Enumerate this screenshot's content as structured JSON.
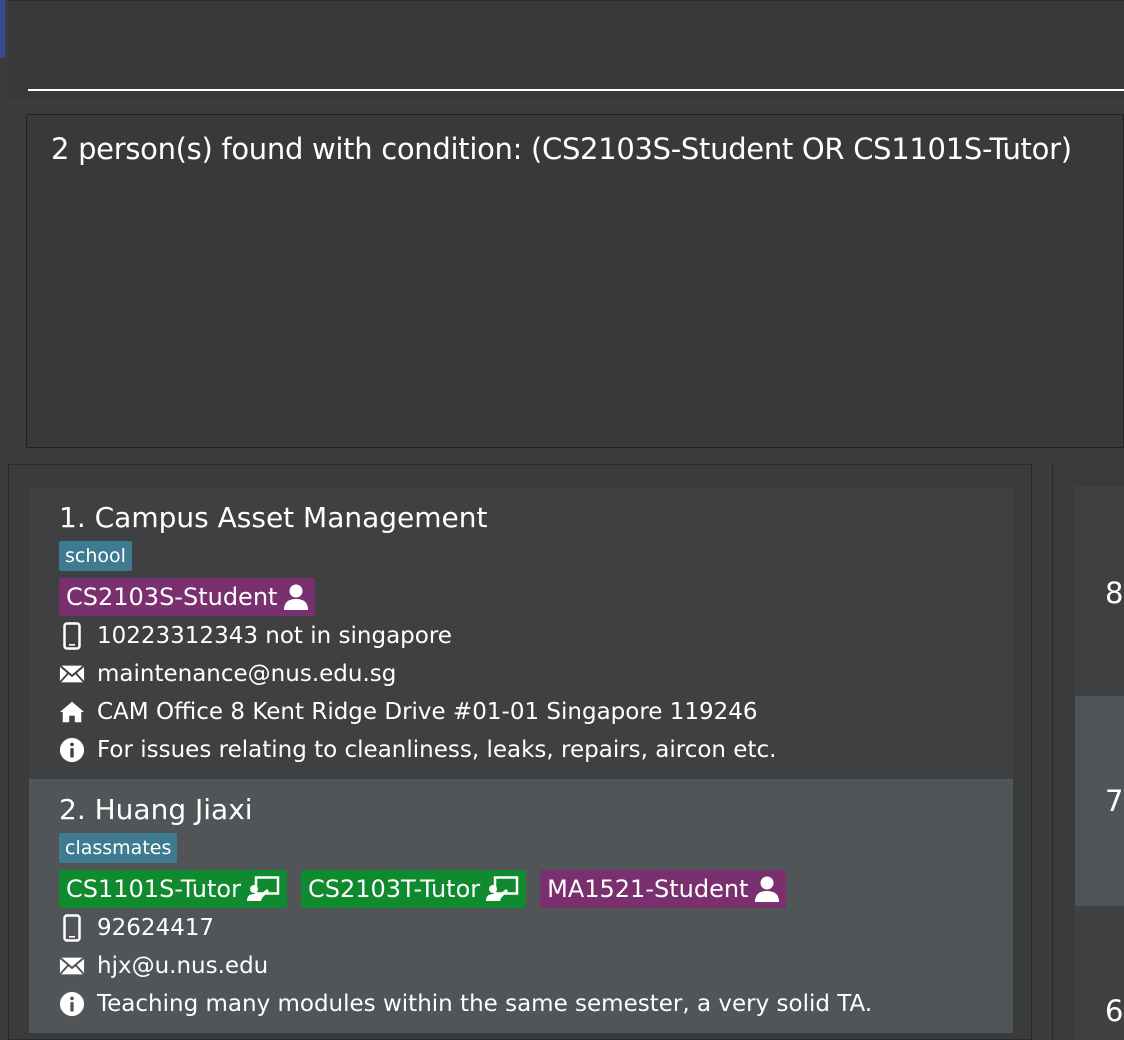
{
  "command": {
    "value": "",
    "placeholder": ""
  },
  "result": {
    "text": "2 person(s) found with condition: (CS2103S-Student OR CS1101S-Tutor)"
  },
  "persons": [
    {
      "name": "1. Campus Asset Management",
      "tags": [
        "school"
      ],
      "modules": [
        {
          "label": "CS2103S-Student",
          "role": "student"
        }
      ],
      "phone": "10223312343 not in singapore",
      "email": "maintenance@nus.edu.sg",
      "address": "CAM Office 8 Kent Ridge Drive #01-01 Singapore 119246",
      "description": "For issues relating to cleanliness, leaks, repairs, aircon etc."
    },
    {
      "name": "2. Huang Jiaxi",
      "tags": [
        "classmates"
      ],
      "modules": [
        {
          "label": "CS1101S-Tutor",
          "role": "tutor"
        },
        {
          "label": "CS2103T-Tutor",
          "role": "tutor"
        },
        {
          "label": "MA1521-Student",
          "role": "student"
        }
      ],
      "phone": "92624417",
      "email": "hjx@u.nus.edu",
      "description": "Teaching many modules within the same semester, a very solid TA."
    }
  ],
  "right_panel": {
    "cells": [
      "8",
      "7",
      "6"
    ]
  },
  "colors": {
    "tag": "#3e7b91",
    "student": "#7a2f6e",
    "tutor": "#0f8a2e",
    "selected_card": "#515558"
  },
  "icons": {
    "phone": "phone-icon",
    "email": "envelope-icon",
    "address": "home-icon",
    "description": "info-icon",
    "student": "person-icon",
    "tutor": "teacher-icon"
  }
}
